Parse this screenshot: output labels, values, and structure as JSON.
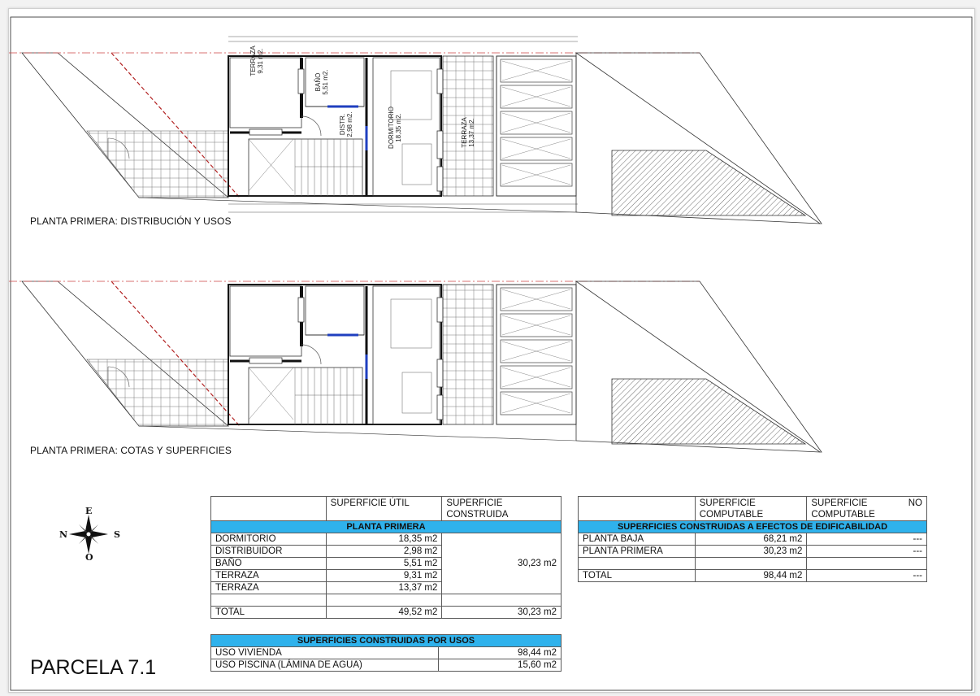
{
  "plans": {
    "top_title": "PLANTA PRIMERA:  DISTRIBUCIÓN Y USOS",
    "bottom_title": "PLANTA PRIMERA:  COTAS Y SUPERFICIES",
    "rooms": [
      {
        "name": "TERRAZA",
        "area": "9,31 m2."
      },
      {
        "name": "BAÑO",
        "area": "5,51 m2."
      },
      {
        "name": "DISTR.",
        "area": "2,98 m2."
      },
      {
        "name": "DORMITORIO",
        "area": "18,35 m2."
      },
      {
        "name": "TERRAZA",
        "area": "13,37 m2."
      }
    ]
  },
  "parcela": "PARCELA 7.1",
  "compass": {
    "n": "N",
    "e": "E",
    "s": "S",
    "o": "O"
  },
  "table_planta": {
    "col1": "SUPERFICIE ÚTIL",
    "col2a": "SUPERFICIE",
    "col2b": "CONSTRUIDA",
    "band": "PLANTA PRIMERA",
    "rows": [
      {
        "name": "DORMITORIO",
        "util": "18,35 m2"
      },
      {
        "name": "DISTRIBUIDOR",
        "util": "2,98 m2"
      },
      {
        "name": "BAÑO",
        "util": "5,51 m2"
      },
      {
        "name": "TERRAZA",
        "util": "9,31 m2"
      },
      {
        "name": "TERRAZA",
        "util": "13,37 m2"
      }
    ],
    "construida": "30,23 m2",
    "total_label": "TOTAL",
    "total_util": "49,52 m2",
    "total_construida": "30,23 m2"
  },
  "table_edif": {
    "col1a": "SUPERFICIE",
    "col1b": "COMPUTABLE",
    "col2a": "SUPERFICIE",
    "col2b": "NO",
    "col2c": "COMPUTABLE",
    "band": "SUPERFICIES CONSTRUIDAS A EFECTOS DE EDIFICABILIDAD",
    "rows": [
      {
        "name": "PLANTA BAJA",
        "comp": "68,21 m2",
        "nocomp": "---"
      },
      {
        "name": "PLANTA PRIMERA",
        "comp": "30,23 m2",
        "nocomp": "---"
      }
    ],
    "total_label": "TOTAL",
    "total_comp": "98,44 m2",
    "total_nocomp": "---"
  },
  "table_usos": {
    "band": "SUPERFICIES CONSTRUIDAS POR USOS",
    "rows": [
      {
        "name": "USO VIVIENDA",
        "value": "98,44 m2"
      },
      {
        "name": "USO PISCINA (LÁMINA DE AGUA)",
        "value": "15,60 m2"
      }
    ]
  }
}
